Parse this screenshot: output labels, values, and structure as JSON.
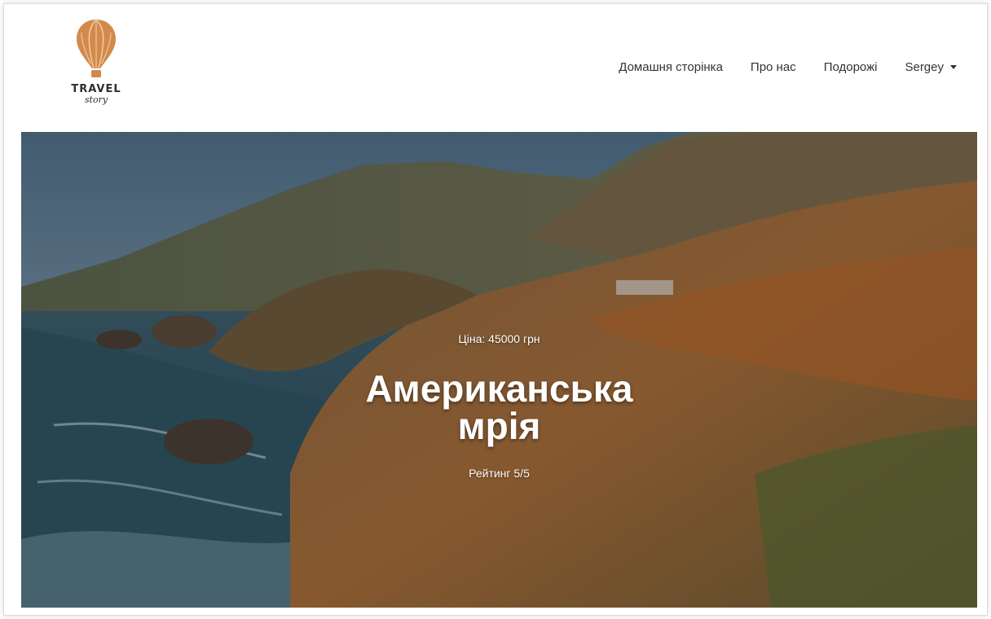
{
  "logo": {
    "word": "TRAVEL",
    "sub": "story",
    "icon": "hot-air-balloon-icon",
    "accent": "#d28a4c"
  },
  "nav": {
    "items": [
      {
        "label": "Домашня сторінка"
      },
      {
        "label": "Про нас"
      },
      {
        "label": "Подорожі"
      },
      {
        "label": "Sergey"
      }
    ],
    "user_menu_icon": "caret-down-icon"
  },
  "hero": {
    "price": "Ціна: 45000 грн",
    "title_line1": "Американська",
    "title_line2": "мрія",
    "rating": "Рейтинг 5/5"
  }
}
